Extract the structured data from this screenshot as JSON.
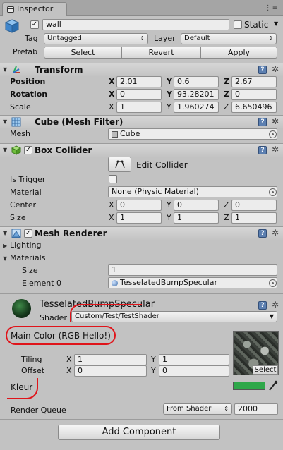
{
  "tab": {
    "title": "Inspector",
    "menu_icon": "⋮≡"
  },
  "object": {
    "name": "wall",
    "active": true,
    "static_label": "Static",
    "tag_label": "Tag",
    "tag_value": "Untagged",
    "layer_label": "Layer",
    "layer_value": "Default",
    "prefab_label": "Prefab",
    "prefab_buttons": [
      "Select",
      "Revert",
      "Apply"
    ]
  },
  "transform": {
    "title": "Transform",
    "rows": [
      {
        "label": "Position",
        "x": "2.01",
        "y": "0.6",
        "z": "2.67"
      },
      {
        "label": "Rotation",
        "x": "0",
        "y": "93.28201",
        "z": "0"
      },
      {
        "label": "Scale",
        "x": "1",
        "y": "1.960274",
        "z": "6.650496"
      }
    ]
  },
  "mesh_filter": {
    "title": "Cube (Mesh Filter)",
    "mesh_label": "Mesh",
    "mesh_value": "Cube"
  },
  "box_collider": {
    "title": "Box Collider",
    "edit_label": "Edit Collider",
    "is_trigger_label": "Is Trigger",
    "material_label": "Material",
    "material_value": "None (Physic Material)",
    "center_label": "Center",
    "center": {
      "x": "0",
      "y": "0",
      "z": "0"
    },
    "size_label": "Size",
    "size": {
      "x": "1",
      "y": "1",
      "z": "1"
    }
  },
  "mesh_renderer": {
    "title": "Mesh Renderer",
    "lighting_label": "Lighting",
    "materials_label": "Materials",
    "size_label": "Size",
    "size_value": "1",
    "element_label": "Element 0",
    "element_value": "TesselatedBumpSpecular"
  },
  "material": {
    "name": "TesselatedBumpSpecular",
    "shader_label": "Shader",
    "shader_value": "Custom/Test/TestShader",
    "main_color_label": "Main Color (RGB Hello!)",
    "tiling_label": "Tiling",
    "tiling": {
      "x": "1",
      "y": "1"
    },
    "offset_label": "Offset",
    "offset": {
      "x": "0",
      "y": "0"
    },
    "texture_select": "Select",
    "kleur_label": "Kleur",
    "kleur_color": "#2fa84a",
    "render_queue_label": "Render Queue",
    "render_queue_mode": "From Shader",
    "render_queue_value": "2000"
  },
  "add_component": "Add Component",
  "xyz": {
    "x": "X",
    "y": "Y",
    "z": "Z"
  },
  "colors": {
    "panel": "#c2c2c2",
    "accent_red": "#e0141a",
    "help_blue": "#5c7fb0"
  }
}
